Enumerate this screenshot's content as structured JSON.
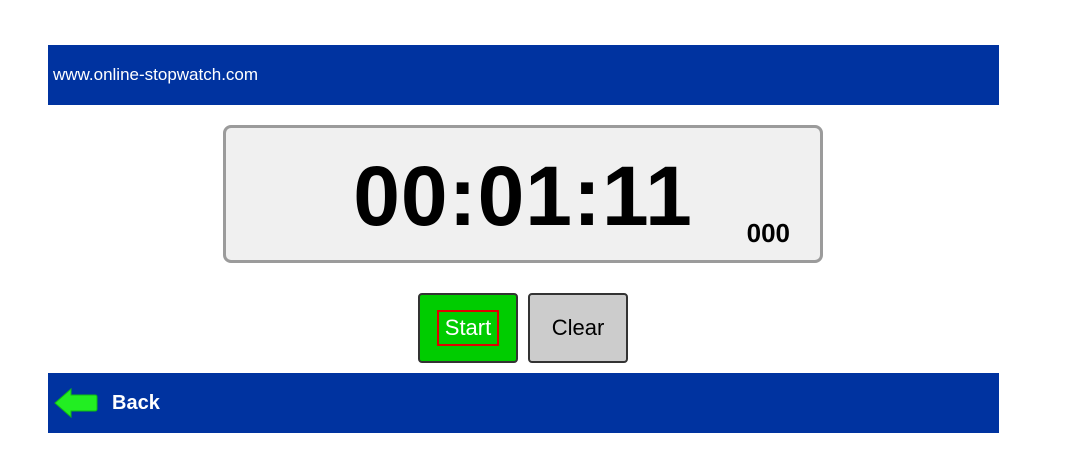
{
  "header": {
    "site_name": "www.online-stopwatch.com"
  },
  "stopwatch": {
    "time": "00:01:11",
    "milliseconds": "000"
  },
  "controls": {
    "start_label": "Start",
    "clear_label": "Clear"
  },
  "footer": {
    "back_label": "Back",
    "back_icon": "back-arrow-icon"
  },
  "colors": {
    "bar": "#0033a0",
    "start_button": "#00cc00",
    "clear_button": "#cccccc",
    "display_bg": "#f0f0f0",
    "focus_outline": "#e00000",
    "back_arrow": "#22ee22"
  }
}
